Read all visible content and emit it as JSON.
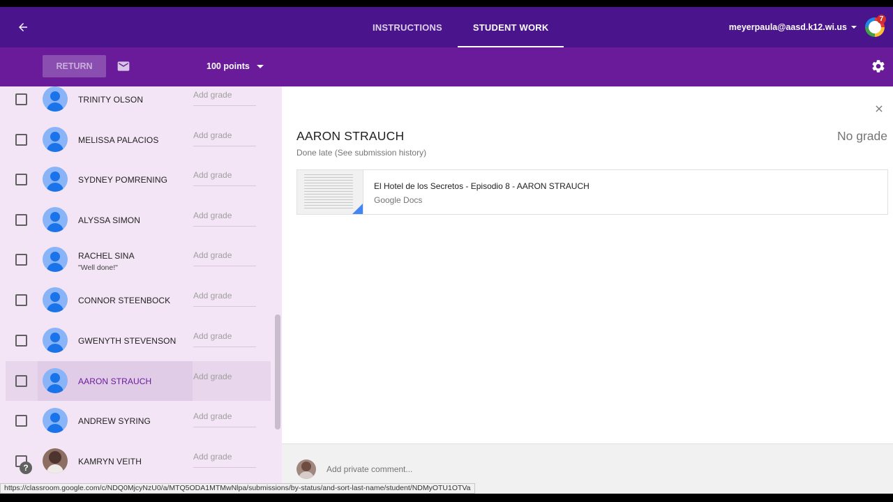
{
  "header": {
    "tabs": [
      {
        "label": "INSTRUCTIONS",
        "active": false
      },
      {
        "label": "STUDENT WORK",
        "active": true
      }
    ],
    "account_email": "meyerpaula@aasd.k12.wi.us",
    "apps_badge_count": "7",
    "icons": {
      "back": "arrow-back-icon",
      "apps": "google-apps-icon"
    }
  },
  "toolbar": {
    "return_label": "RETURN",
    "points_label": "100 points",
    "icons": {
      "mail": "mail-icon",
      "settings": "gear-icon"
    }
  },
  "students": [
    {
      "name": "TRINITY OLSON",
      "comment": "",
      "grade_placeholder": "Add grade",
      "selected": false
    },
    {
      "name": "MELISSA PALACIOS",
      "comment": "",
      "grade_placeholder": "Add grade",
      "selected": false
    },
    {
      "name": "SYDNEY POMRENING",
      "comment": "",
      "grade_placeholder": "Add grade",
      "selected": false
    },
    {
      "name": "ALYSSA SIMON",
      "comment": "",
      "grade_placeholder": "Add grade",
      "selected": false
    },
    {
      "name": "RACHEL SINA",
      "comment": "\"Well done!\"",
      "grade_placeholder": "Add grade",
      "selected": false
    },
    {
      "name": "CONNOR STEENBOCK",
      "comment": "",
      "grade_placeholder": "Add grade",
      "selected": false
    },
    {
      "name": "GWENYTH STEVENSON",
      "comment": "",
      "grade_placeholder": "Add grade",
      "selected": false
    },
    {
      "name": "AARON STRAUCH",
      "comment": "",
      "grade_placeholder": "Add grade",
      "selected": true
    },
    {
      "name": "ANDREW SYRING",
      "comment": "",
      "grade_placeholder": "Add grade",
      "selected": false
    },
    {
      "name": "KAMRYN VEITH",
      "comment": "",
      "grade_placeholder": "Add grade",
      "selected": false
    }
  ],
  "detail": {
    "student_name": "AARON STRAUCH",
    "status": "Done late (See submission history)",
    "grade": "No grade",
    "attachment": {
      "title": "El Hotel de los Secretos - Episodio 8 - AARON STRAUCH",
      "type": "Google Docs"
    }
  },
  "comment_bar": {
    "placeholder": "Add private comment..."
  },
  "help_label": "?",
  "status_url": "https://classroom.google.com/c/NDQ0MjcyNzU0/a/MTQ5ODA1MTMwNlpa/submissions/by-status/and-sort-last-name/student/NDMyOTU1OTVa",
  "colors": {
    "header": "#4a148c",
    "toolbar": "#6a1b9a",
    "list_bg": "#f3e5f5",
    "accent": "#6a1b9a"
  }
}
